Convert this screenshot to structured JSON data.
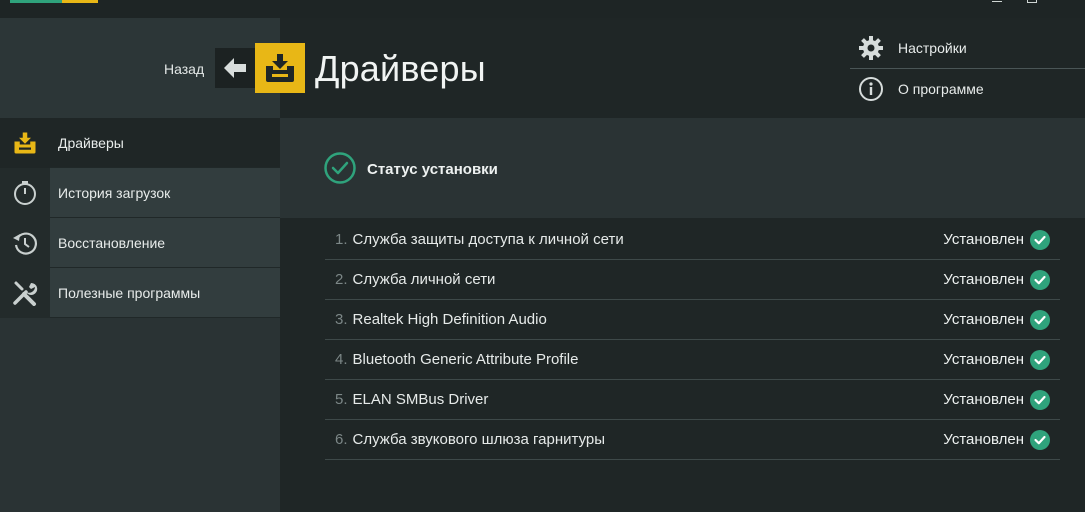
{
  "window": {
    "accent_green": "#2fa37c",
    "accent_yellow": "#e8b716"
  },
  "header": {
    "back_label": "Назад",
    "title": "Драйверы",
    "page_icon": "driver-tray-icon"
  },
  "top_menu": [
    {
      "label": "Настройки",
      "icon": "gear-icon"
    },
    {
      "label": "О программе",
      "icon": "info-icon"
    }
  ],
  "sidebar": {
    "items": [
      {
        "label": "Драйверы",
        "icon": "driver-tray-icon",
        "active": true
      },
      {
        "label": "История загрузок",
        "icon": "clock-icon",
        "active": false
      },
      {
        "label": "Восстановление",
        "icon": "restore-icon",
        "active": false
      },
      {
        "label": "Полезные программы",
        "icon": "tools-icon",
        "active": false
      }
    ]
  },
  "status": {
    "title": "Статус установки",
    "icon": "check-circle-icon"
  },
  "drivers": [
    {
      "num": "1.",
      "name": "Служба защиты доступа к личной сети",
      "status": "Установлен"
    },
    {
      "num": "2.",
      "name": "Служба личной сети",
      "status": "Установлен"
    },
    {
      "num": "3.",
      "name": "Realtek High Definition Audio",
      "status": "Установлен"
    },
    {
      "num": "4.",
      "name": "Bluetooth Generic Attribute Profile",
      "status": "Установлен"
    },
    {
      "num": "5.",
      "name": "ELAN SMBus Driver",
      "status": "Установлен"
    },
    {
      "num": "6.",
      "name": "Служба звукового шлюза гарнитуры",
      "status": "Установлен"
    }
  ]
}
